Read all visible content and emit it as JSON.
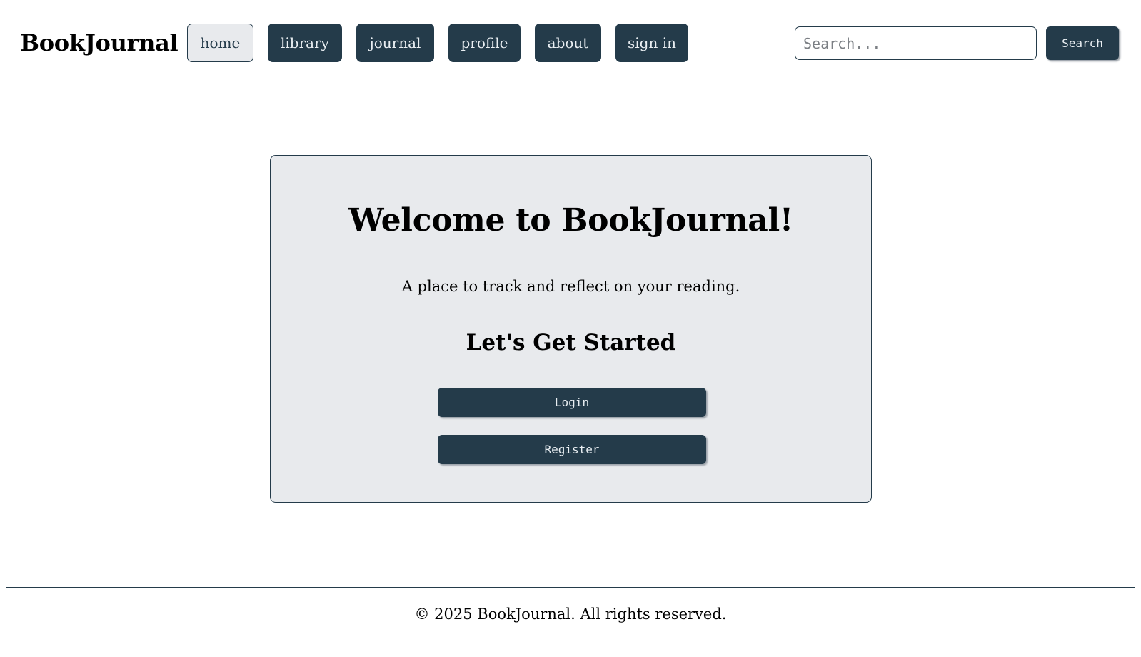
{
  "app": {
    "title": "BookJournal"
  },
  "nav": {
    "items": [
      {
        "label": "home",
        "active": true
      },
      {
        "label": "library",
        "active": false
      },
      {
        "label": "journal",
        "active": false
      },
      {
        "label": "profile",
        "active": false
      },
      {
        "label": "about",
        "active": false
      },
      {
        "label": "sign in",
        "active": false
      }
    ]
  },
  "search": {
    "placeholder": "Search...",
    "value": "",
    "button_label": "Search"
  },
  "welcome": {
    "title": "Welcome to BookJournal!",
    "subtitle": "A place to track and reflect on your reading.",
    "heading": "Let's Get Started",
    "login_label": "Login",
    "register_label": "Register"
  },
  "footer": {
    "text": "© 2025 BookJournal. All rights reserved."
  },
  "colors": {
    "primary": "#243b4a",
    "card_bg": "#e8eaed",
    "button_text": "#e9eef2"
  }
}
